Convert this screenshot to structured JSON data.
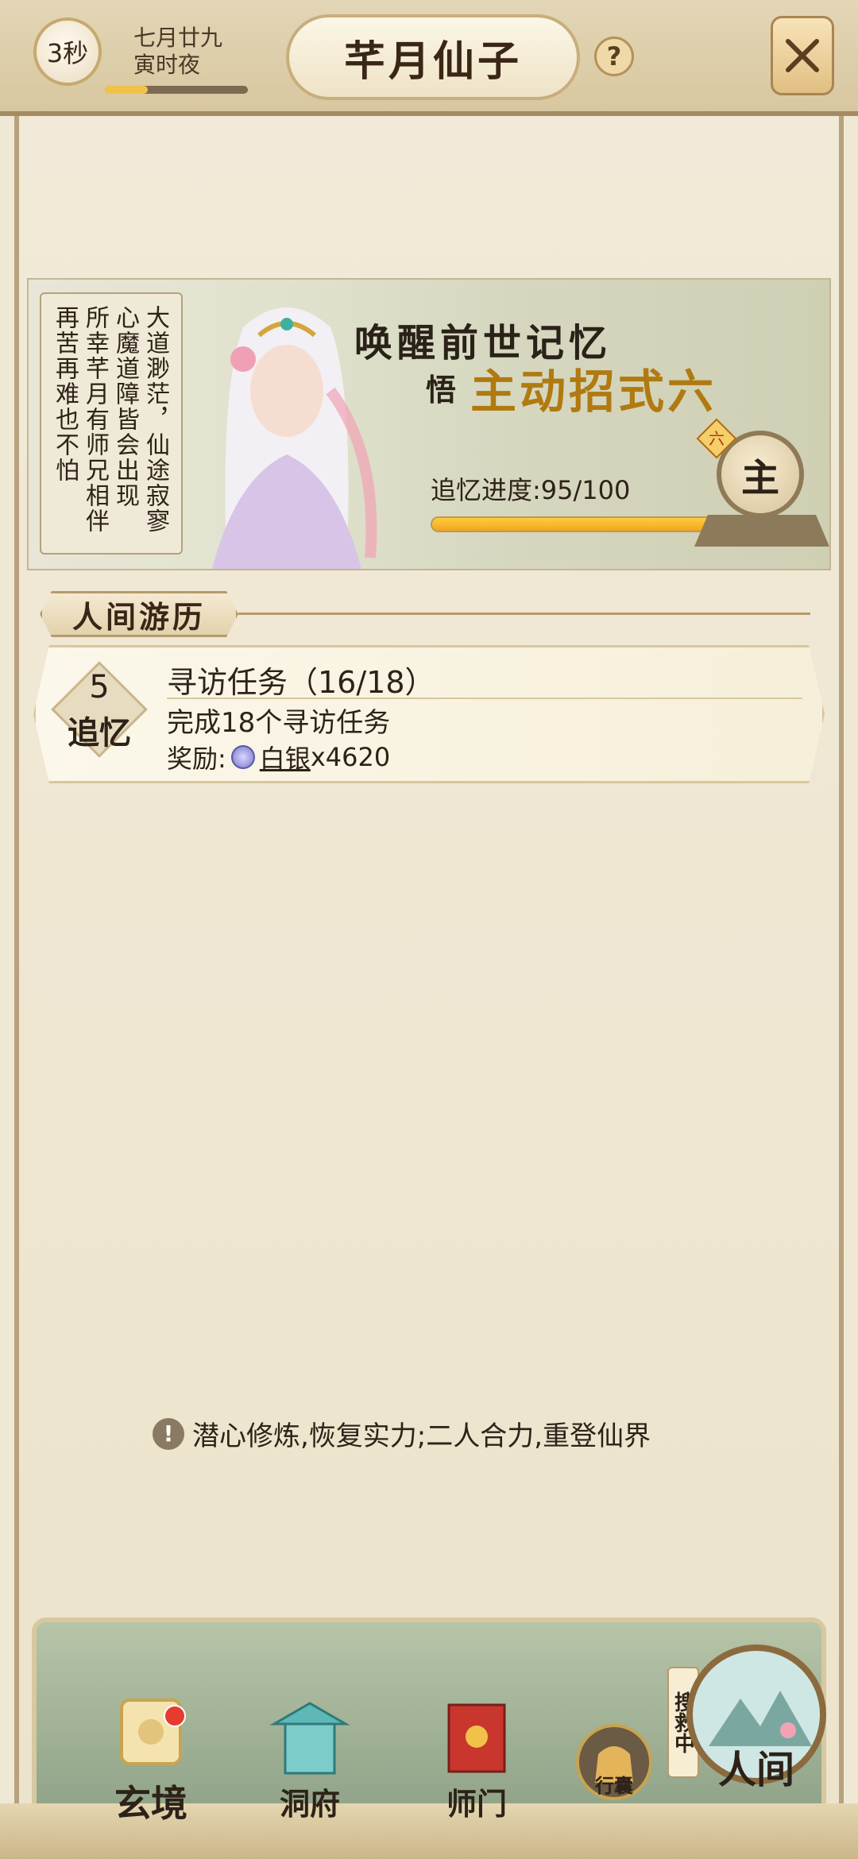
{
  "header": {
    "timer": "3秒",
    "date": "七月廿九",
    "period": "寅时夜",
    "title": "芊月仙子",
    "help_glyph": "?",
    "time_progress": 0.3
  },
  "banner": {
    "poem": [
      "大道渺茫，仙途寂寥",
      "心魔道障皆会出现",
      "所幸芊月有师兄相伴",
      "再苦再难也不怕"
    ],
    "headline": "唤醒前世记忆",
    "subhead_prefix": "悟",
    "subhead_main": "主动招式六",
    "progress_label": "追忆进度:95/100",
    "progress_value": 95,
    "progress_max": 100,
    "badge_char": "主",
    "badge_tag": "六"
  },
  "section": {
    "title": "人间游历"
  },
  "task": {
    "level": "5",
    "tag": "追忆",
    "title": "寻访任务（16/18）",
    "desc": "完成18个寻访任务",
    "reward_label": "奖励:",
    "reward_item": "白银",
    "reward_amount": "x4620"
  },
  "tip": {
    "text": "潜心修炼,恢复实力;二人合力,重登仙界"
  },
  "nav": {
    "items": [
      {
        "label": "玄境"
      },
      {
        "label": "洞府"
      },
      {
        "label": "师门"
      },
      {
        "label": "行囊"
      },
      {
        "label": "人间"
      }
    ],
    "search_tag": "搜救中"
  },
  "colors": {
    "accent_gold": "#f1a51d",
    "text_dark": "#2d2218",
    "alert_red": "#e63b2e"
  }
}
